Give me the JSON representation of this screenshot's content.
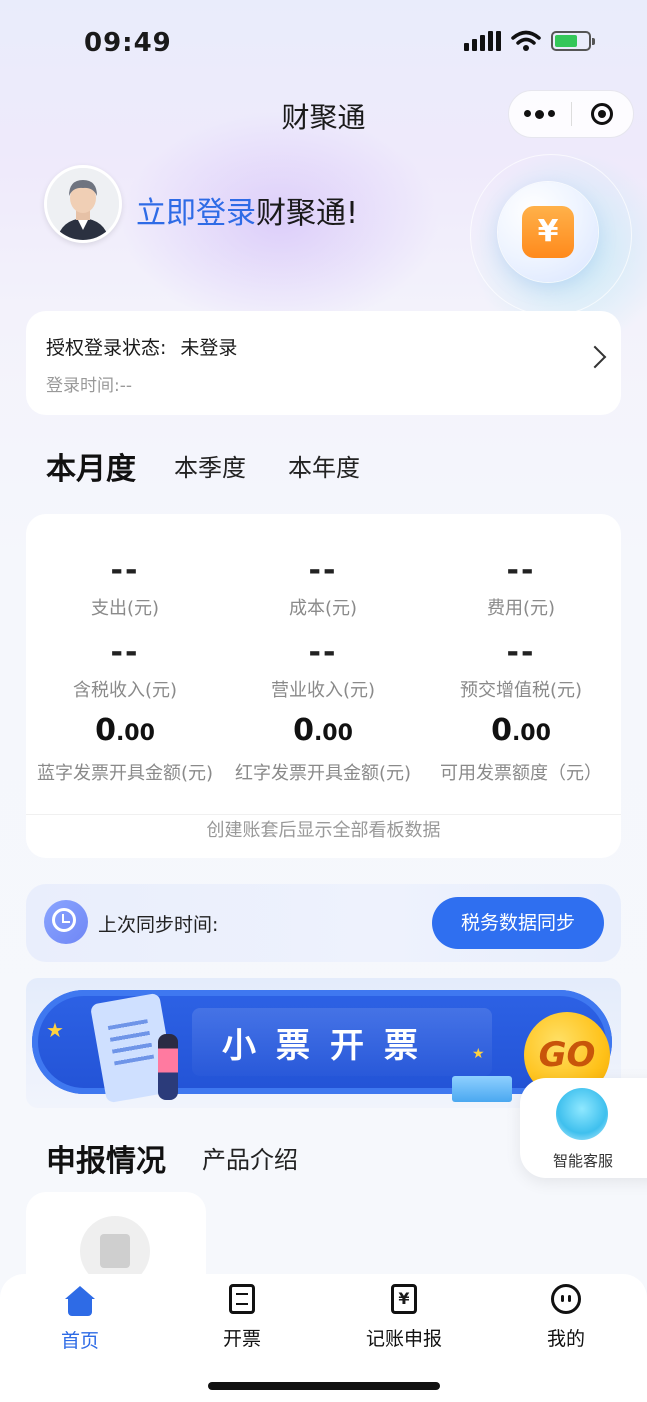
{
  "status_bar": {
    "time": "09:49"
  },
  "nav": {
    "title": "财聚通",
    "more_icon": "more-dots-icon",
    "close_icon": "target-circle-icon"
  },
  "user": {
    "login_link": "立即登录",
    "login_suffix": "财聚通!",
    "coin_symbol": "¥"
  },
  "auth": {
    "status_label": "授权登录状态:",
    "status_value": "未登录",
    "time_label": "登录时间:",
    "time_value": "--"
  },
  "period_tabs": [
    "本月度",
    "本季度",
    "本年度"
  ],
  "stats": {
    "items": [
      {
        "value": "--",
        "label": "支出(元)"
      },
      {
        "value": "--",
        "label": "成本(元)"
      },
      {
        "value": "--",
        "label": "费用(元)"
      },
      {
        "value": "--",
        "label": "含税收入(元)"
      },
      {
        "value": "--",
        "label": "营业收入(元)"
      },
      {
        "value": "--",
        "label": "预交增值税(元)"
      },
      {
        "int": "0",
        "dec": ".00",
        "label": "蓝字发票开具金额(元)"
      },
      {
        "int": "0",
        "dec": ".00",
        "label": "红字发票开具金额(元)"
      },
      {
        "int": "0",
        "dec": ".00",
        "label": "可用发票额度（元）"
      }
    ],
    "note": "创建账套后显示全部看板数据"
  },
  "sync": {
    "label": "上次同步时间:",
    "button": "税务数据同步"
  },
  "banner": {
    "text": "小票开票",
    "go": "GO"
  },
  "service": {
    "label": "智能客服"
  },
  "report_tabs": [
    "申报情况",
    "产品介绍"
  ],
  "tabbar": [
    "首页",
    "开票",
    "记账申报",
    "我的"
  ],
  "colors": {
    "accent": "#2e6be6",
    "button": "#2f6ff0",
    "banner": "#2353d6"
  }
}
